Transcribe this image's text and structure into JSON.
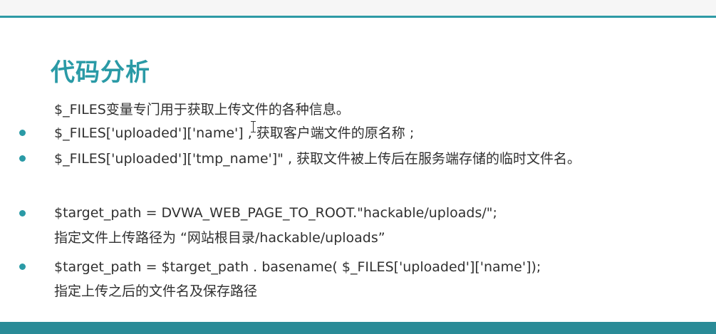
{
  "slide": {
    "title": "代码分析",
    "accent_color": "#2a9aa6",
    "lines": [
      {
        "text": "$_FILES变量专门用于获取上传文件的各种信息。",
        "bullet": false
      },
      {
        "text": "$_FILES['uploaded']['name'] , 获取客户端文件的原名称 ;",
        "bullet": true
      },
      {
        "text": "$_FILES['uploaded']['tmp_name']\" , 获取文件被上传后在服务端存储的临时文件名。",
        "bullet": true
      },
      {
        "text": "$target_path = DVWA_WEB_PAGE_TO_ROOT.\"hackable/uploads/\";",
        "bullet": true
      },
      {
        "text": "指定文件上传路径为 “网站根目录/hackable/uploads”",
        "bullet": false
      },
      {
        "text": "$target_path = $target_path . basename( $_FILES['uploaded']['name']);",
        "bullet": true
      },
      {
        "text": "指定上传之后的文件名及保存路径",
        "bullet": false
      }
    ]
  }
}
